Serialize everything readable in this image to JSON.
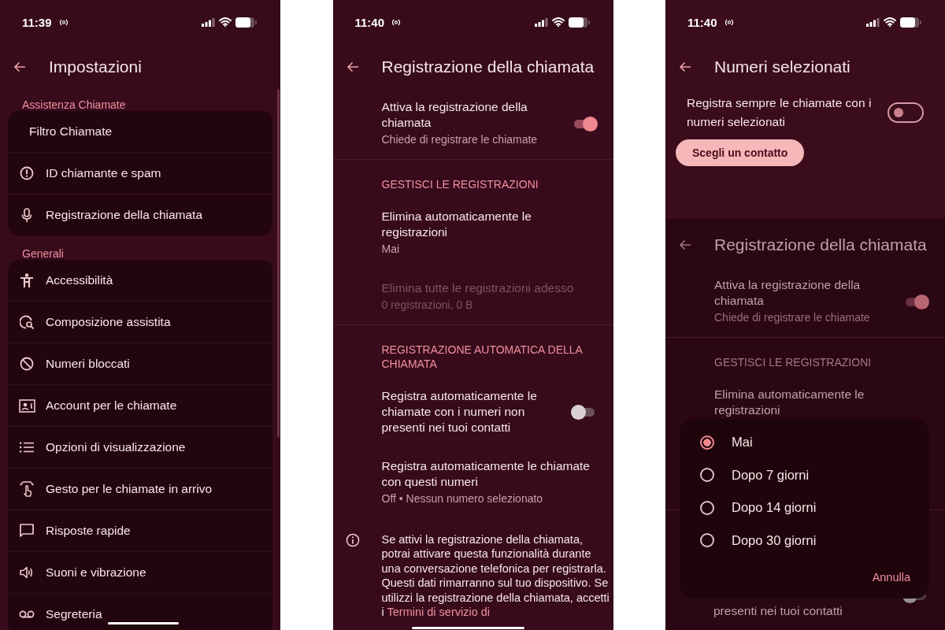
{
  "screens": [
    {
      "kind": "settings",
      "status_bar": {
        "time": "11:39"
      },
      "title": "Impostazioni",
      "groups": [
        {
          "header": "Assistenza Chiamate",
          "items": [
            {
              "label": "Filtro Chiamate"
            },
            {
              "label": "ID chiamante e spam"
            },
            {
              "label": "Registrazione della chiamata"
            }
          ]
        },
        {
          "header": "Generali",
          "items": [
            {
              "label": "Accessibilità"
            },
            {
              "label": "Composizione assistita"
            },
            {
              "label": "Numeri bloccati"
            },
            {
              "label": "Account per le chiamate"
            },
            {
              "label": "Opzioni di visualizzazione"
            },
            {
              "label": "Gesto per le chiamate in arrivo"
            },
            {
              "label": "Risposte rapide"
            },
            {
              "label": "Suoni e vibrazione"
            },
            {
              "label": "Segreteria"
            }
          ]
        }
      ]
    },
    {
      "kind": "recording",
      "status_bar": {
        "time": "11:40"
      },
      "title": "Registrazione della chiamata",
      "sections": [
        {
          "rows": [
            {
              "kind": "switch",
              "title": "Attiva la registrazione della chiamata",
              "subtitle": "Chiede di registrare le chiamate",
              "on": true,
              "disabled": false
            }
          ]
        },
        {
          "header": "GESTISCI LE REGISTRAZIONI",
          "rows": [
            {
              "kind": "plain",
              "title": "Elimina automaticamente le registrazioni",
              "subtitle": "Mai",
              "disabled": false
            },
            {
              "kind": "plain",
              "title": "Elimina tutte le registrazioni adesso",
              "subtitle": "0 registrazioni, 0 B",
              "disabled": true
            }
          ]
        },
        {
          "header": "REGISTRAZIONE AUTOMATICA DELLA CHIAMATA",
          "rows": [
            {
              "kind": "switch",
              "title": "Registra automaticamente le chiamate con i numeri non presenti nei tuoi contatti",
              "on": false,
              "disabled": false
            },
            {
              "kind": "plain",
              "title": "Registra automaticamente le chiamate con questi numeri",
              "subtitle": "Off • Nessun numero selezionato",
              "disabled": false
            }
          ]
        }
      ],
      "info": {
        "text": "Se attivi la registrazione della chiamata, potrai attivare questa funzionalità durante una conversazione telefonica per registrarla. Questi dati rimarranno sul tuo dispositivo. Se utilizzi la registrazione della chiamata, accetti i",
        "link": "Termini di servizio di"
      }
    },
    {
      "kind": "selected_numbers",
      "status_bar": {
        "time": "11:40"
      },
      "title": "Numeri selezionati",
      "switch_row": {
        "title": "Registra sempre le chiamate con i numeri selezionati",
        "on": false
      },
      "button": "Scegli un contatto",
      "background": {
        "title": "Registrazione della chiamata",
        "sections": [
          {
            "rows": [
              {
                "kind": "switch",
                "title": "Attiva la registrazione della chiamata",
                "subtitle": "Chiede di registrare le chiamate",
                "on": true,
                "disabled": false
              }
            ]
          },
          {
            "header": "GESTISCI LE REGISTRAZIONI",
            "rows": [
              {
                "kind": "plain",
                "title": "Elimina automaticamente le registrazioni",
                "disabled": false
              }
            ]
          }
        ],
        "tail": {
          "title": "presenti nei tuoi contatti",
          "on": false
        }
      },
      "dialog": {
        "options": [
          {
            "label": "Mai",
            "selected": true
          },
          {
            "label": "Dopo 7 giorni",
            "selected": false
          },
          {
            "label": "Dopo 14 giorni",
            "selected": false
          },
          {
            "label": "Dopo 30 giorni",
            "selected": false
          }
        ],
        "cancel": "Annulla"
      }
    }
  ]
}
